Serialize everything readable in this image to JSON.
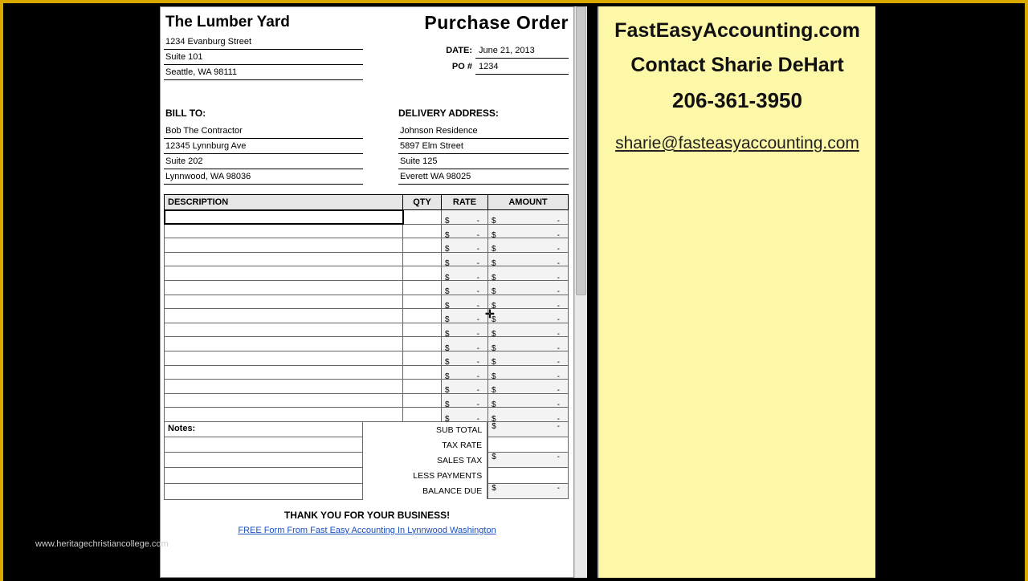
{
  "watermark": "www.heritagechristiancollege.com",
  "doc": {
    "company": "The Lumber Yard",
    "title": "Purchase Order",
    "address": [
      "1234 Evanburg Street",
      "Suite 101",
      "Seattle, WA 98111"
    ],
    "meta": {
      "date_label": "DATE:",
      "date": "June 21, 2013",
      "po_label": "PO #",
      "po": "1234"
    },
    "billto_label": "BILL TO:",
    "billto": [
      "Bob The Contractor",
      "12345 Lynnburg Ave",
      "Suite 202",
      "Lynnwood, WA 98036"
    ],
    "delivery_label": "DELIVERY ADDRESS:",
    "delivery": [
      "Johnson Residence",
      "5897 Elm Street",
      "Suite 125",
      "Everett WA 98025"
    ],
    "columns": {
      "desc": "DESCRIPTION",
      "qty": "QTY",
      "rate": "RATE",
      "amount": "AMOUNT"
    },
    "item_rows": 15,
    "currency": "$",
    "dash": "-",
    "notes_label": "Notes:",
    "totals": {
      "subtotal": "SUB TOTAL",
      "taxrate": "TAX RATE",
      "salestax": "SALES TAX",
      "lesspayments": "LESS PAYMENTS",
      "balancedue": "BALANCE DUE"
    },
    "thankyou": "THANK YOU FOR YOUR BUSINESS!",
    "freelink": "FREE Form From Fast Easy Accounting In Lynnwood Washington"
  },
  "sidebar": {
    "line1": "FastEasyAccounting.com",
    "line2": "Contact Sharie DeHart",
    "line3": "206-361-3950",
    "email": "sharie@fasteasyaccounting.com"
  }
}
